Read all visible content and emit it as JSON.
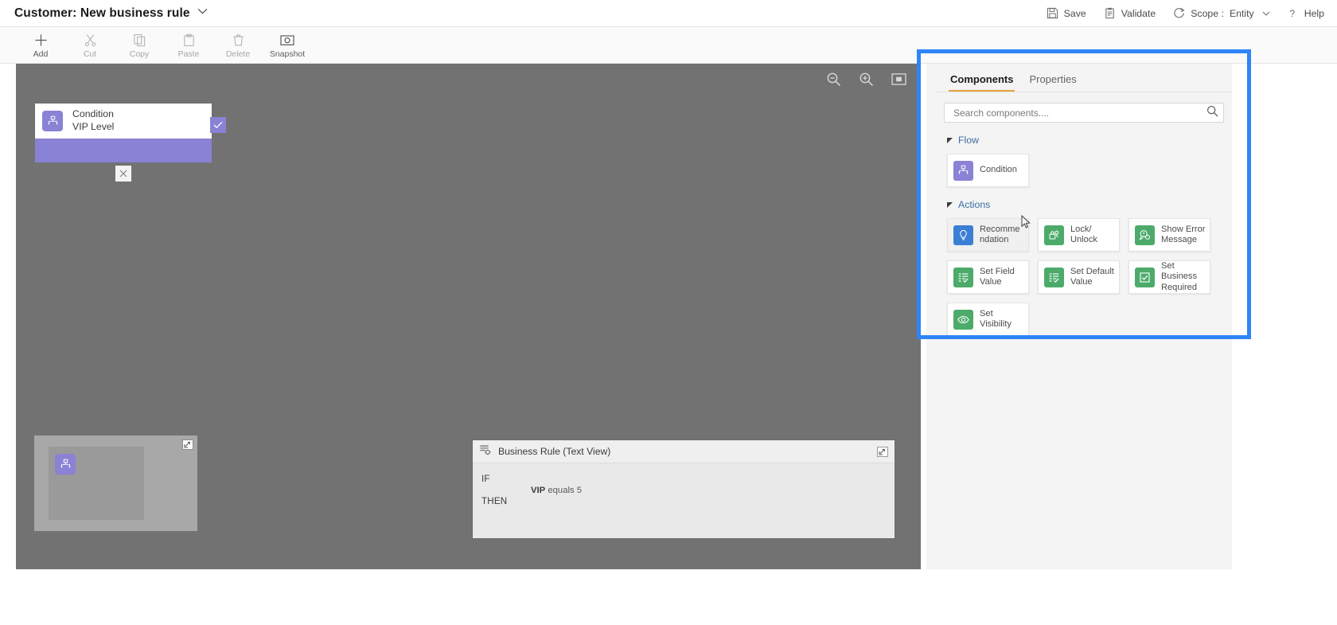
{
  "titlebar": {
    "title": "Customer: New business rule",
    "chevron": "chevron-down-icon",
    "commands": [
      {
        "id": "save",
        "label": "Save",
        "icon": "save-icon"
      },
      {
        "id": "validate",
        "label": "Validate",
        "icon": "validate-icon"
      },
      {
        "id": "scope",
        "label": "Scope :",
        "icon": "scope-icon",
        "value": "Entity"
      },
      {
        "id": "help",
        "label": "Help",
        "icon": "help-icon"
      }
    ]
  },
  "ribbon": {
    "tools": [
      {
        "id": "add",
        "label": "Add",
        "icon": "plus-icon",
        "enabled": true
      },
      {
        "id": "cut",
        "label": "Cut",
        "icon": "scissors-icon",
        "enabled": false
      },
      {
        "id": "copy",
        "label": "Copy",
        "icon": "copy-icon",
        "enabled": false
      },
      {
        "id": "paste",
        "label": "Paste",
        "icon": "paste-icon",
        "enabled": false
      },
      {
        "id": "delete",
        "label": "Delete",
        "icon": "trash-icon",
        "enabled": false
      },
      {
        "id": "snapshot",
        "label": "Snapshot",
        "icon": "camera-icon",
        "enabled": true
      }
    ]
  },
  "canvas": {
    "zoom_controls": [
      {
        "id": "zoom-out",
        "icon": "zoom-out-icon"
      },
      {
        "id": "zoom-in",
        "icon": "zoom-in-icon"
      },
      {
        "id": "fit",
        "icon": "fit-to-screen-icon"
      }
    ],
    "node": {
      "icon": "condition-icon",
      "title": "Condition",
      "subtitle": "VIP Level",
      "check_icon": "check-icon",
      "close_icon": "close-icon",
      "accent": "#8a82d4"
    },
    "minimap": {
      "expand_icon": "expand-icon",
      "node_icon": "condition-icon"
    },
    "background": "#727272"
  },
  "textview": {
    "icon": "business-rule-icon",
    "title": "Business Rule (Text View)",
    "expand_icon": "expand-icon",
    "lines": [
      {
        "keyword": "IF",
        "clause_bold": "",
        "clause_rest": ""
      },
      {
        "keyword": "",
        "clause_bold": "VIP",
        "clause_rest": "equals 5"
      },
      {
        "keyword": "THEN",
        "clause_bold": "",
        "clause_rest": ""
      }
    ]
  },
  "rightpane": {
    "tabs": [
      {
        "id": "components",
        "label": "Components",
        "active": true
      },
      {
        "id": "properties",
        "label": "Properties",
        "active": false
      }
    ],
    "search": {
      "placeholder": "Search components....",
      "value": "",
      "icon": "search-icon"
    },
    "groups": [
      {
        "id": "flow",
        "label": "Flow",
        "expanded": true,
        "tiles": [
          {
            "id": "condition",
            "label": "Condition",
            "icon": "condition-icon",
            "color": "#8a82d4",
            "hover": false
          }
        ]
      },
      {
        "id": "actions",
        "label": "Actions",
        "expanded": true,
        "tiles": [
          {
            "id": "recommendation",
            "label": "Recomme\nndation",
            "icon": "lightbulb-icon",
            "color": "#3a7fd5",
            "hover": true
          },
          {
            "id": "lock-unlock",
            "label": "Lock/\nUnlock",
            "icon": "lock-icon",
            "color": "#4cab6a",
            "hover": false
          },
          {
            "id": "show-error-message",
            "label": "Show Error\nMessage",
            "icon": "error-message-icon",
            "color": "#4cab6a",
            "hover": false
          },
          {
            "id": "set-field-value",
            "label": "Set Field\nValue",
            "icon": "field-value-icon",
            "color": "#4cab6a",
            "hover": false
          },
          {
            "id": "set-default-value",
            "label": "Set Default\nValue",
            "icon": "field-value-icon",
            "color": "#4cab6a",
            "hover": false
          },
          {
            "id": "set-business-required",
            "label": "Set\nBusiness\nRequired",
            "icon": "checkbox-icon",
            "color": "#4cab6a",
            "hover": false
          },
          {
            "id": "set-visibility",
            "label": "Set\nVisibility",
            "icon": "eye-icon",
            "color": "#4cab6a",
            "hover": false
          }
        ]
      }
    ],
    "highlight_color": "#2f84f7"
  }
}
